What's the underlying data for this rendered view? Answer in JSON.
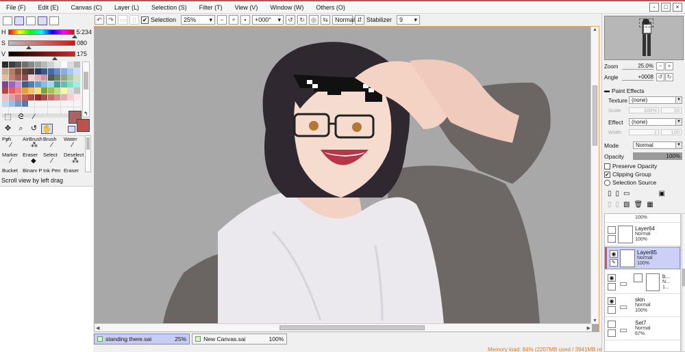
{
  "menu": [
    "File (F)",
    "Edit (E)",
    "Canvas (C)",
    "Layer (L)",
    "Selection (S)",
    "Filter (T)",
    "View (V)",
    "Window (W)",
    "Others (O)"
  ],
  "window_controls": {
    "minimize": "-",
    "restore": "□",
    "close": "×"
  },
  "toolbar": {
    "selection_label": "Selection",
    "selection_checked": "✔",
    "zoom": "25%",
    "angle": "+000°",
    "blend_mode": "Normal",
    "stabilizer_label": "Stabilizer",
    "stabilizer_value": "9"
  },
  "color_sliders": [
    {
      "label": "H",
      "value": "5:234",
      "thumb_fraction": 0.99
    },
    {
      "label": "S",
      "value": "080",
      "thumb_fraction": 0.31
    },
    {
      "label": "V",
      "value": "175",
      "thumb_fraction": 0.69
    }
  ],
  "colors": {
    "foreground": "#b05f62",
    "background": "#c0504d",
    "accent": "#e8a35b",
    "active_layer": "#ccd0f7",
    "active_tab": "#c7cdf3",
    "memory_text": "#d97a1b"
  },
  "swatches": [
    "#2a2a2a",
    "#3d3d3d",
    "#555",
    "#6e6e6e",
    "#888",
    "#a0a0a0",
    "#b8b8b8",
    "#d0d0d0",
    "#e8e8e8",
    "#fff",
    "#ddd",
    "#bbb",
    "#c9a98a",
    "#b08060",
    "#805040",
    "#604030",
    "#4a3a3a",
    "#2a3a5a",
    "#3a5a8a",
    "#4a6aaa",
    "#6a8aca",
    "#8aaae0",
    "#aac8f0",
    "#c8e0ff",
    "#e0c0a0",
    "#c08070",
    "#a06060",
    "#885050",
    "#f0d0d0",
    "#e8b0b8",
    "#d890a0",
    "#4a6050",
    "#6a8060",
    "#90a880",
    "#b0c8a0",
    "#d0e0c0",
    "#8040a0",
    "#a060c0",
    "#c090e0",
    "#406080",
    "#5080b0",
    "#60a0d0",
    "#80c0e0",
    "#a0d8f0",
    "#40a0a0",
    "#60c0b0",
    "#80e0c0",
    "#a0f0e0",
    "#c04040",
    "#e06060",
    "#f08080",
    "#e0a040",
    "#f0c060",
    "#f8e080",
    "#80a040",
    "#a0c060",
    "#c0e080",
    "#f8f8a0",
    "#e0e0e0",
    "#c0c0c0",
    "#f0c0c0",
    "#e0a0a0",
    "#d08080",
    "#c06060",
    "#b04848",
    "#903030",
    "#a05050",
    "#c07070",
    "#d09090",
    "#e0b0b0",
    "#f0d0d0",
    "#fae8e8",
    "#b8d8f8",
    "#98c0e8",
    "#7898c8",
    "#5878a8",
    "#f4f4f4",
    "#f4f4f4",
    "#f4f4f4",
    "#f4f4f4",
    "#f4f4f4",
    "#f4f4f4",
    "#f4f4f4",
    "#f4f4f4",
    "#f4f4f4",
    "#f4f4f4",
    "#f4f4f4",
    "#f4f4f4",
    "#f4f4f4",
    "#f4f4f4",
    "#f4f4f4",
    "#f4f4f4",
    "#f4f4f4",
    "#f4f4f4",
    "#f4f4f4",
    "#f4f4f4"
  ],
  "tools": [
    {
      "name": "rect-select-tool",
      "glyph": "⬚"
    },
    {
      "name": "lasso-tool",
      "glyph": "ᘓ"
    },
    {
      "name": "magic-wand-tool",
      "glyph": "⁄"
    },
    {
      "name": "blank-tool",
      "glyph": ""
    },
    {
      "name": "move-tool",
      "glyph": "✥"
    },
    {
      "name": "zoom-tool",
      "glyph": "⌕"
    },
    {
      "name": "rotate-tool",
      "glyph": "↺"
    },
    {
      "name": "hand-tool",
      "glyph": "✋"
    },
    {
      "name": "eyedropper-tool",
      "glyph": "⁄"
    }
  ],
  "brushes": [
    {
      "label": "Pen",
      "glyph": "⁄"
    },
    {
      "label": "AirBrush",
      "glyph": "⁂"
    },
    {
      "label": "Brush",
      "glyph": "⁄"
    },
    {
      "label": "Water",
      "glyph": "⁄"
    },
    {
      "label": "Marker",
      "glyph": "⁄"
    },
    {
      "label": "Eraser",
      "glyph": "◆"
    },
    {
      "label": "Select",
      "glyph": "⁄"
    },
    {
      "label": "Deselect",
      "glyph": "⁂"
    },
    {
      "label": "Bucket",
      "glyph": ""
    },
    {
      "label": "Binary P",
      "glyph": ""
    },
    {
      "label": "Ink Pen",
      "glyph": ""
    },
    {
      "label": "Eraser",
      "glyph": ""
    }
  ],
  "status_hint": "Scroll view by left drag",
  "documents": [
    {
      "name": "standing there.sai",
      "zoom": "25%"
    },
    {
      "name": "New Canvas.sai",
      "zoom": "100%"
    }
  ],
  "memory": "Memory load: 84% (2207MB used / 3941MB reserved)",
  "key_indicators": [
    "Shft",
    "Ctrl",
    "Alt",
    "SPC",
    "Any"
  ],
  "navigator": {
    "zoom_label": "Zoom",
    "zoom_value": "25.0%",
    "angle_label": "Angle",
    "angle_value": "+0008"
  },
  "paint_effects": {
    "title": "Paint Effects",
    "texture_label": "Texture",
    "texture_value": "(none)",
    "scale_label": "Scale",
    "scale_value": "100%",
    "scale_num": "20",
    "effect_label": "Effect",
    "effect_value": "(none)",
    "width_label": "Width",
    "width_value": "1",
    "width_num": "100"
  },
  "layer_props": {
    "mode_label": "Mode",
    "mode_value": "Normal",
    "opacity_label": "Opacity",
    "opacity_value": "100%",
    "preserve_opacity": "Preserve Opacity",
    "clipping_group": "Clipping Group",
    "selection_source": "Selection Source"
  },
  "layers": [
    {
      "name": "",
      "mode": "",
      "opacity": "100%",
      "type": "partial"
    },
    {
      "name": "Layer64",
      "mode": "Normal",
      "opacity": "100%",
      "type": "layer"
    },
    {
      "name": "Layer85",
      "mode": "Normal",
      "opacity": "100%",
      "type": "layer",
      "active": true
    },
    {
      "name": "b...",
      "mode": "N...",
      "opacity": "1...",
      "type": "folder-masked"
    },
    {
      "name": "skin",
      "mode": "Normal",
      "opacity": "100%",
      "type": "folder"
    },
    {
      "name": "Set7",
      "mode": "Normal",
      "opacity": "67%",
      "type": "folder"
    }
  ]
}
